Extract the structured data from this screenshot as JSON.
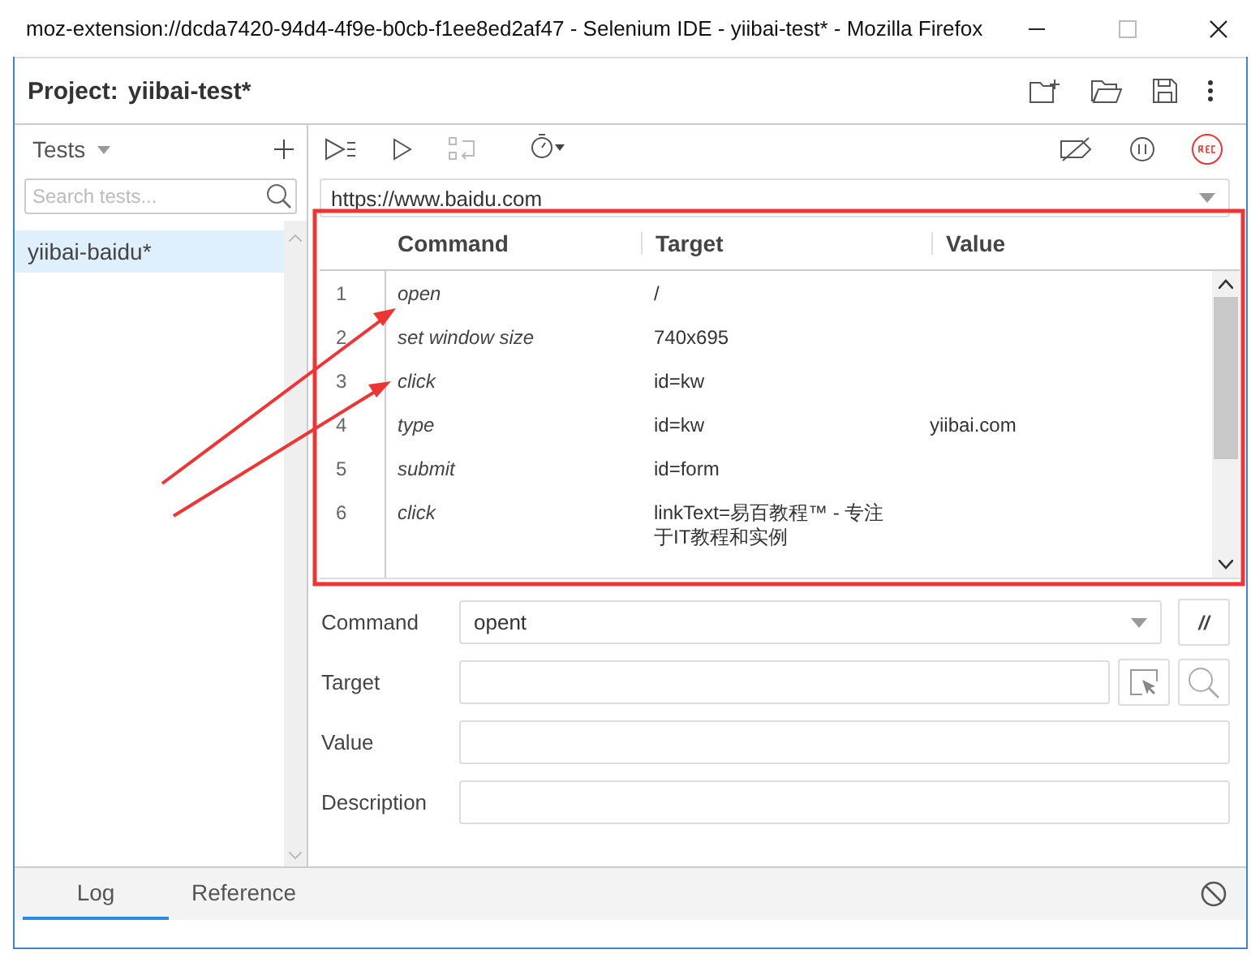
{
  "window": {
    "title": "moz-extension://dcda7420-94d4-4f9e-b0cb-f1ee8ed2af47 - Selenium IDE - yiibai-test* - Mozilla Firefox"
  },
  "project": {
    "label": "Project:",
    "name": "yiibai-test*"
  },
  "sidebar": {
    "title": "Tests",
    "search": {
      "placeholder": "Search tests..."
    },
    "items": [
      {
        "label": "yiibai-baidu*",
        "selected": true
      }
    ]
  },
  "url": {
    "value": "https://www.baidu.com"
  },
  "table": {
    "columns": [
      "Command",
      "Target",
      "Value"
    ],
    "rows": [
      {
        "number": "1",
        "command": "open",
        "target": "/"
      },
      {
        "number": "2",
        "command": "set window size",
        "target": "740x695"
      },
      {
        "number": "3",
        "command": "click",
        "target": "id=kw"
      },
      {
        "number": "4",
        "command": "type",
        "target": "id=kw",
        "value": "yiibai.com"
      },
      {
        "number": "5",
        "command": "submit",
        "target": "id=form"
      },
      {
        "number": "6",
        "command": "click",
        "target": "linkText=易百教程™ - 专注于IT教程和实例"
      }
    ]
  },
  "form": {
    "fields": [
      {
        "label": "Command",
        "kind": "select",
        "value": "opent",
        "button": "//"
      },
      {
        "label": "Target",
        "kind": "target"
      },
      {
        "label": "Value",
        "kind": "text"
      },
      {
        "label": "Description",
        "kind": "text"
      }
    ]
  },
  "panel": {
    "tabs": [
      {
        "label": "Log",
        "selected": true
      },
      {
        "label": "Reference",
        "selected": false
      }
    ]
  }
}
